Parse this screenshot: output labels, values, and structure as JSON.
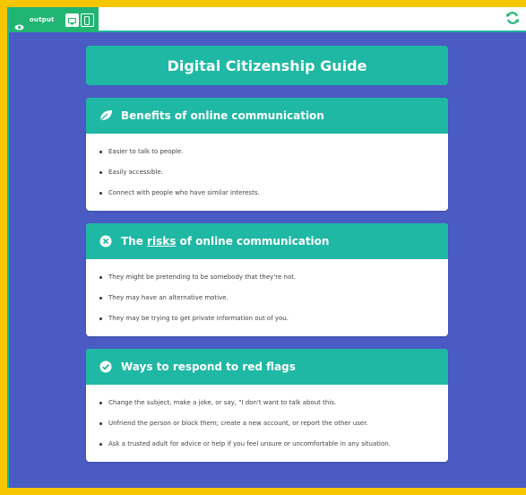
{
  "topbar": {
    "output_label": "output",
    "icons": [
      "eye-icon",
      "desktop-icon",
      "mobile-icon",
      "refresh-icon"
    ],
    "accent": "#21b573"
  },
  "page": {
    "title": "Digital Citizenship Guide",
    "colors": {
      "background": "#4a5bc4",
      "teal": "#1fb8a4",
      "frame": "#f6c600"
    }
  },
  "cards": [
    {
      "icon": "leaf-icon",
      "heading_before": "Benefits of online communication",
      "heading_underlined": "",
      "heading_after": "",
      "items": [
        "Easier to talk to people.",
        "Easily accessible.",
        "Connect with people who have similar interests."
      ]
    },
    {
      "icon": "x-circle-icon",
      "heading_before": "The ",
      "heading_underlined": "risks",
      "heading_after": " of online communication",
      "items": [
        "They might be pretending to be somebody that they're not.",
        "They may have an alternative motive.",
        "They may be trying to get private information out of you."
      ]
    },
    {
      "icon": "check-circle-icon",
      "heading_before": "Ways to respond to red flags",
      "heading_underlined": "",
      "heading_after": "",
      "items": [
        "Change the subject, make a joke, or say, \"I don't want to talk about this.",
        "Unfriend the person or block them; create a new account, or report the other user.",
        "Ask a trusted adult for advice or help if you feel unsure or uncomfortable in any situation."
      ]
    }
  ]
}
